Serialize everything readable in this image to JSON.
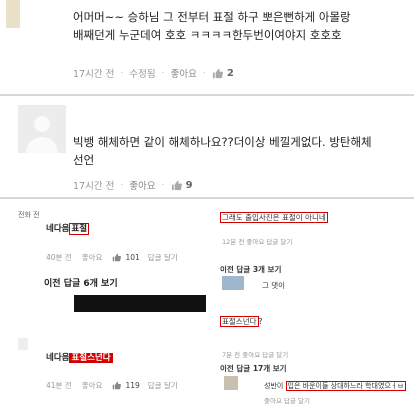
{
  "comment1": {
    "text": "어머머~~ 승하님 그 전부터 표절 하구 뽀은뻔하게 아몰랑 배째던게 누군데여 호호 ㅋㅋㅋㅋ한두번이여야지 호호호",
    "time": "17시간 전",
    "edit": "수정됨",
    "like": "좋아요",
    "like_count": "2"
  },
  "comment2": {
    "text": "빅뱅 해체하면 같이 해체하나요??더이상 베낄게없다. 방탄해체 선언",
    "time": "17시간 전",
    "like": "좋아요",
    "like_count": "9"
  },
  "left_block1": {
    "small_label": "전화 전",
    "name_prefix": "네다음",
    "name_highlight": "표절",
    "time": "40분 전",
    "like": "좋아요",
    "count": "101",
    "reply": "답글 달기",
    "prev_replies": "이전 답글 6개 보기"
  },
  "left_block2": {
    "name_prefix": "네다음",
    "name_highlight": "표절스넌다",
    "time": "41분 전",
    "like": "좋아요",
    "count": "119",
    "reply": "답글 달기"
  },
  "right_block": {
    "line1": "그래도 출입사진은 표절이 아니네",
    "meta1": "12분 전  좋아요  답글 달기",
    "prev1": "이전 답글 3개 보기",
    "reply1": "그 댓이",
    "highlight2": "표절스넌다",
    "after2": "?",
    "meta2": "7분 전  좋아요  답글 달기",
    "prev2": "이전 답글 17개 보기",
    "reply3_prefix": "성반이 ",
    "reply3_highlight": "입은 바운이들 상대하느라 학대였으ㅓㅂ",
    "meta3": "좋아요  답글 달기"
  }
}
